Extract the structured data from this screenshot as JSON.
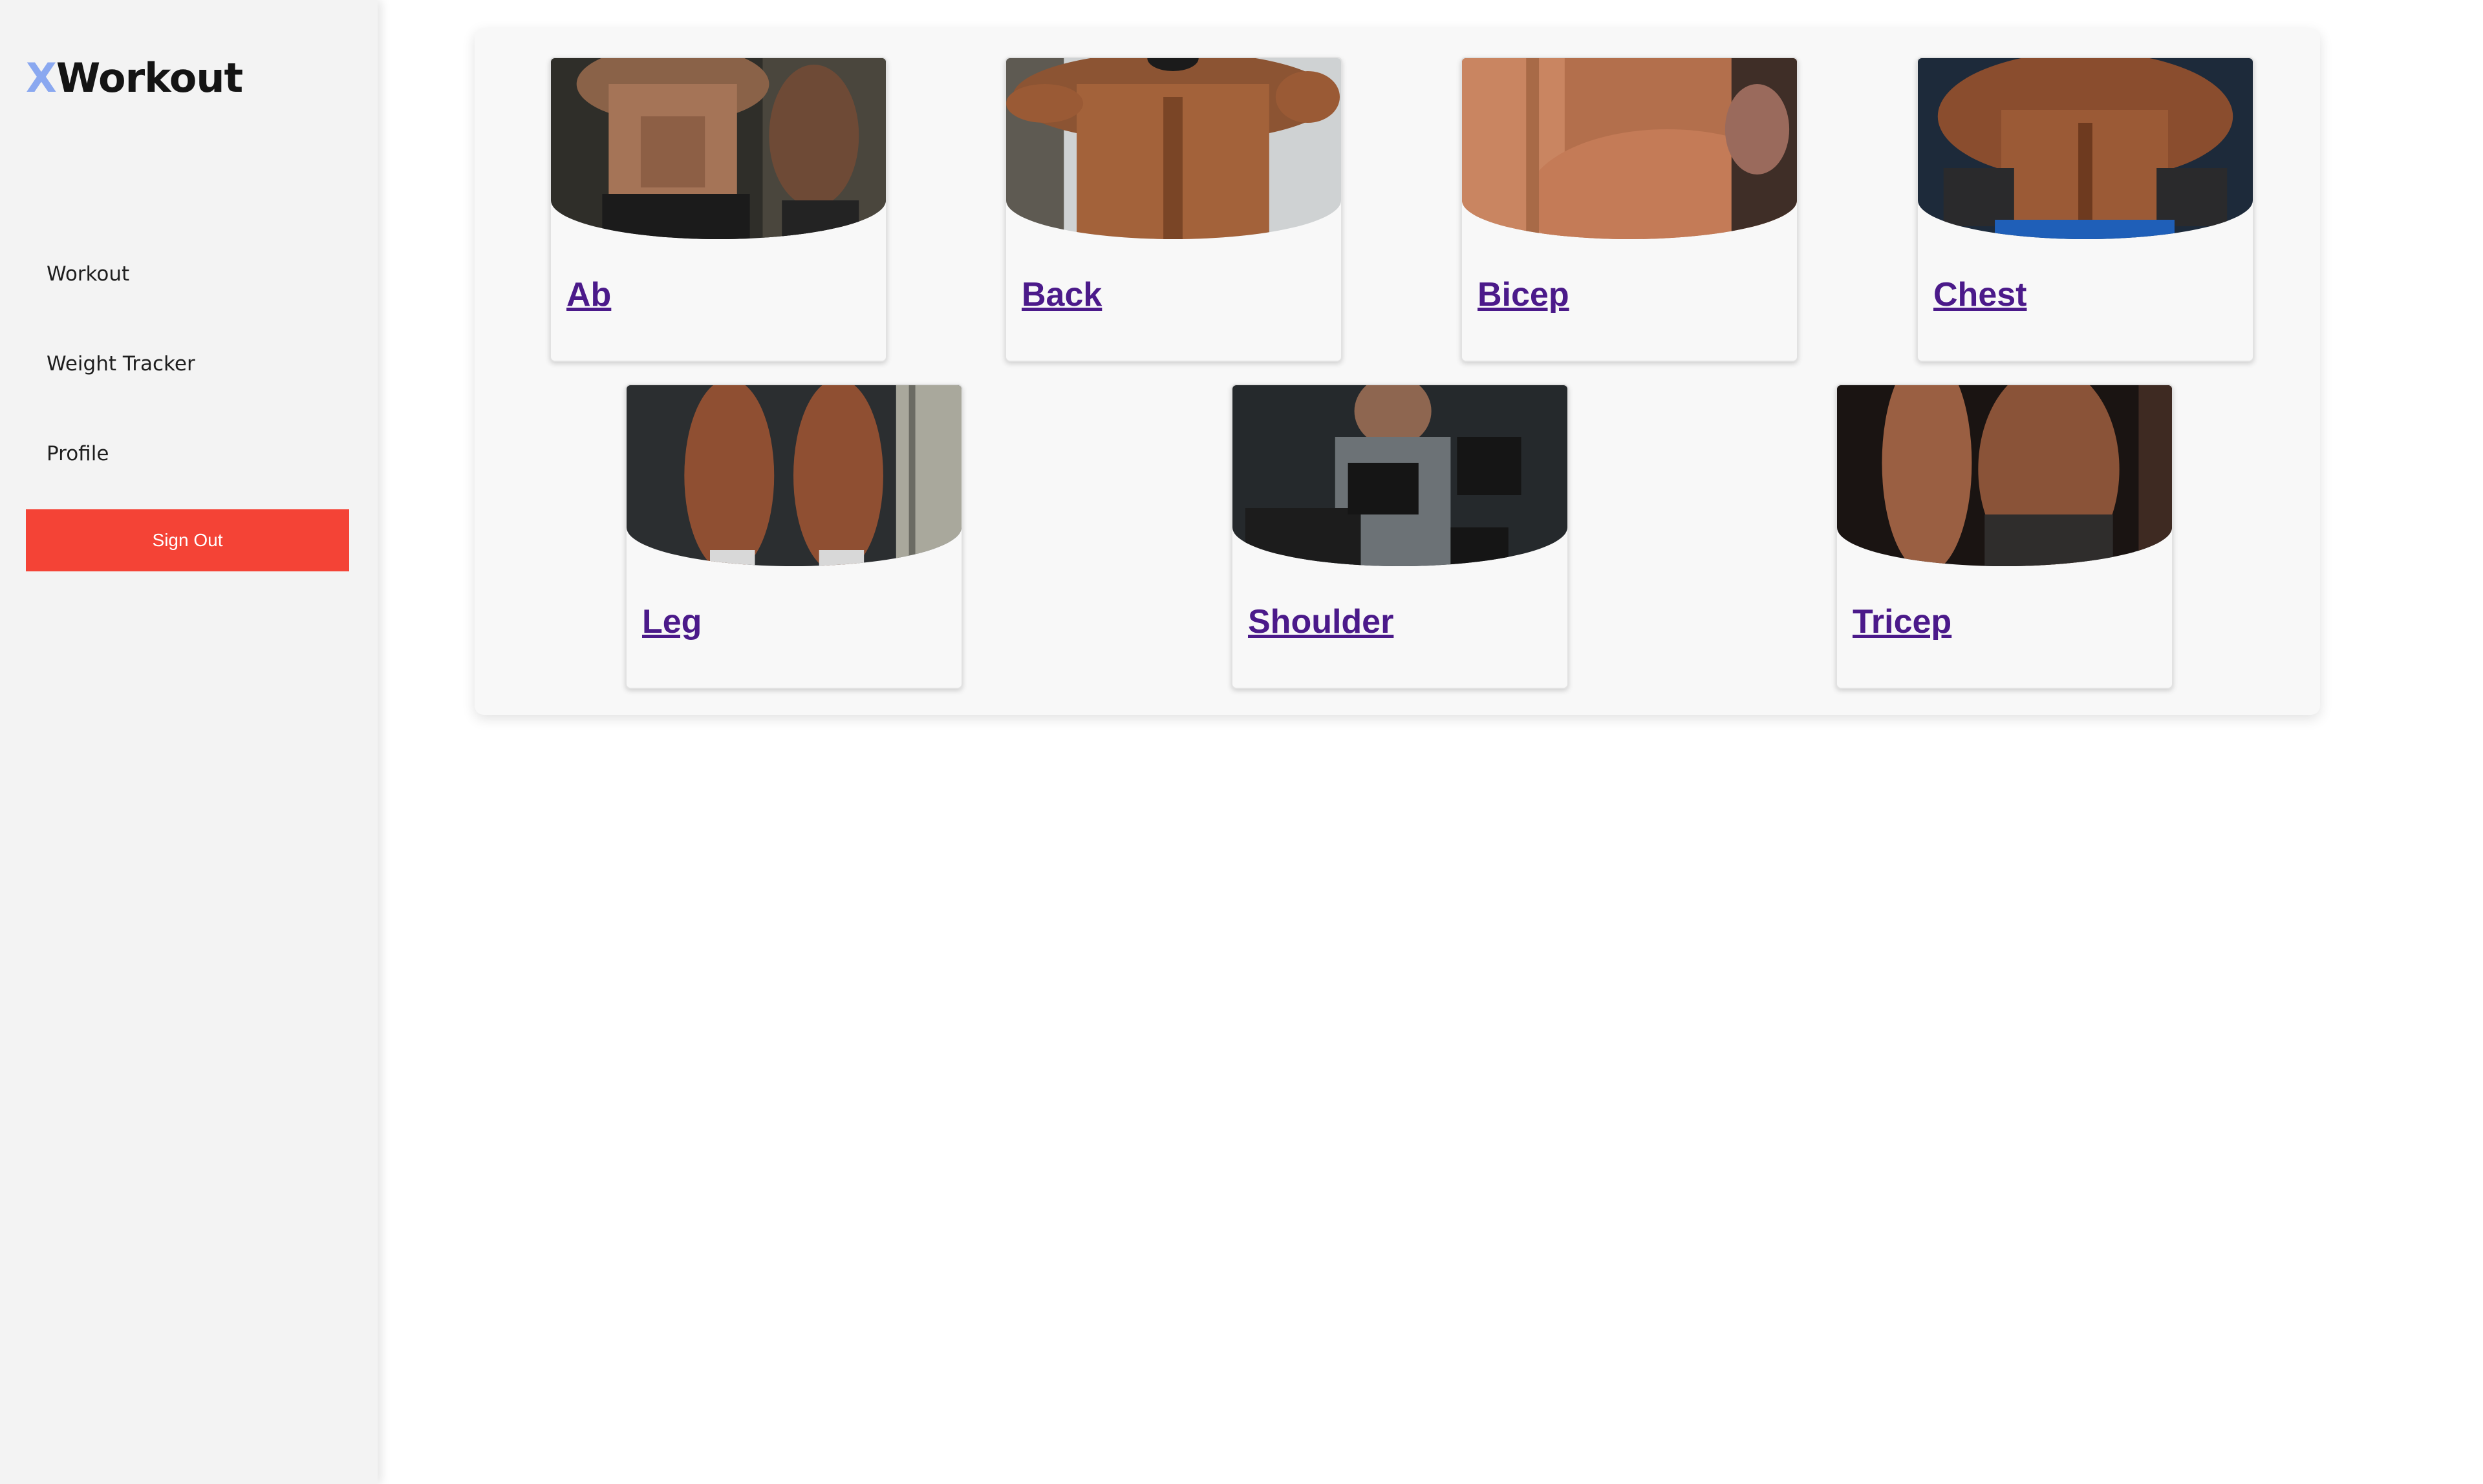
{
  "app": {
    "logo_accent": "X",
    "logo_rest": "Workout"
  },
  "sidebar": {
    "items": [
      {
        "label": "Workout"
      },
      {
        "label": "Weight Tracker"
      },
      {
        "label": "Profile"
      }
    ],
    "signout_label": "Sign Out"
  },
  "categories": [
    {
      "label": "Ab"
    },
    {
      "label": "Back"
    },
    {
      "label": "Bicep"
    },
    {
      "label": "Chest"
    },
    {
      "label": "Leg"
    },
    {
      "label": "Shoulder"
    },
    {
      "label": "Tricep"
    }
  ],
  "colors": {
    "accent": "#8aa8f0",
    "signout": "#f44336",
    "link": "#4b1a8a",
    "sidebar_bg": "#f3f3f3"
  }
}
